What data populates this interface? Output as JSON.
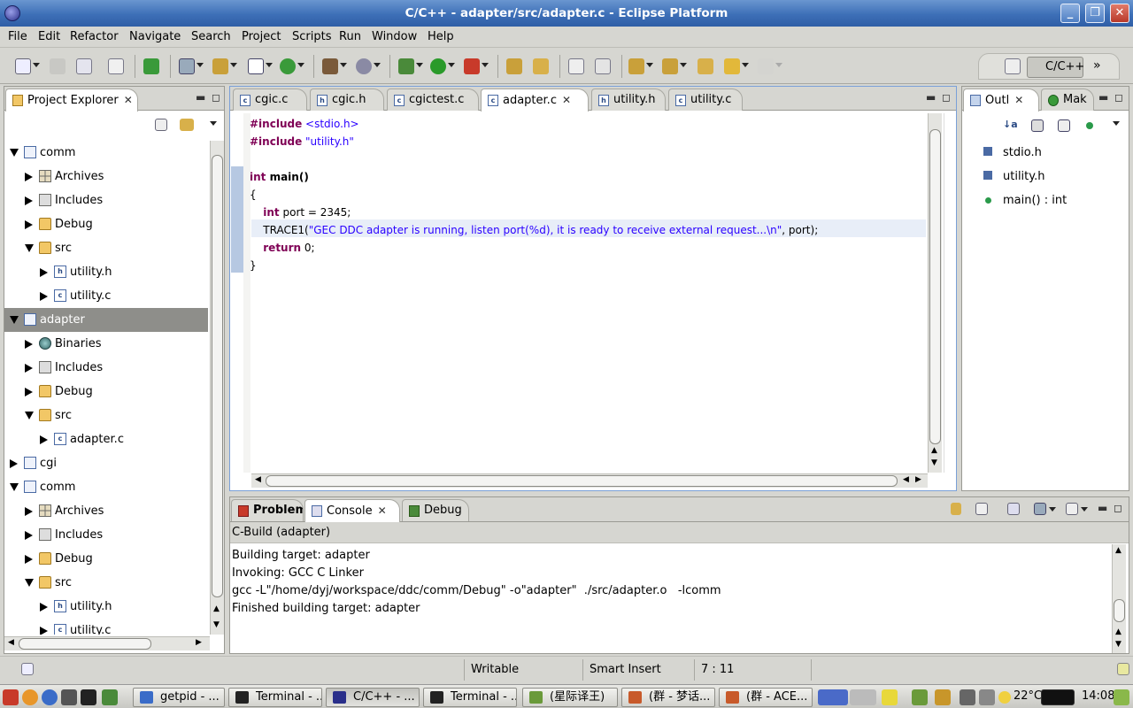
{
  "window": {
    "title": "C/C++ - adapter/src/adapter.c - Eclipse Platform",
    "min": "_",
    "max": "❐",
    "close": "✕"
  },
  "menu": [
    "File",
    "Edit",
    "Refactor",
    "Navigate",
    "Search",
    "Project",
    "Scripts",
    "Run",
    "Window",
    "Help"
  ],
  "perspective": {
    "label": "C/C++",
    "more": "»"
  },
  "explorer": {
    "title": "Project Explorer",
    "tree": [
      {
        "label": "comm",
        "depth": 0,
        "state": "open",
        "icon": "project-icon"
      },
      {
        "label": "Archives",
        "depth": 1,
        "state": "closed",
        "icon": "archive-icon"
      },
      {
        "label": "Includes",
        "depth": 1,
        "state": "closed",
        "icon": "includes-icon"
      },
      {
        "label": "Debug",
        "depth": 1,
        "state": "closed",
        "icon": "folder-icon"
      },
      {
        "label": "src",
        "depth": 1,
        "state": "open",
        "icon": "folder-icon"
      },
      {
        "label": "utility.h",
        "depth": 2,
        "state": "closed",
        "icon": "header-file-icon"
      },
      {
        "label": "utility.c",
        "depth": 2,
        "state": "closed",
        "icon": "c-file-icon"
      },
      {
        "label": "adapter",
        "depth": 0,
        "state": "open",
        "icon": "project-icon",
        "selected": true
      },
      {
        "label": "Binaries",
        "depth": 1,
        "state": "closed",
        "icon": "binaries-icon"
      },
      {
        "label": "Includes",
        "depth": 1,
        "state": "closed",
        "icon": "includes-icon"
      },
      {
        "label": "Debug",
        "depth": 1,
        "state": "closed",
        "icon": "folder-icon"
      },
      {
        "label": "src",
        "depth": 1,
        "state": "open",
        "icon": "folder-icon"
      },
      {
        "label": "adapter.c",
        "depth": 2,
        "state": "closed",
        "icon": "c-file-icon"
      },
      {
        "label": "cgi",
        "depth": 0,
        "state": "closed",
        "icon": "project-icon"
      },
      {
        "label": "comm",
        "depth": 0,
        "state": "open",
        "icon": "project-icon"
      },
      {
        "label": "Archives",
        "depth": 1,
        "state": "closed",
        "icon": "archive-icon"
      },
      {
        "label": "Includes",
        "depth": 1,
        "state": "closed",
        "icon": "includes-icon"
      },
      {
        "label": "Debug",
        "depth": 1,
        "state": "closed",
        "icon": "folder-icon"
      },
      {
        "label": "src",
        "depth": 1,
        "state": "open",
        "icon": "folder-icon"
      },
      {
        "label": "utility.h",
        "depth": 2,
        "state": "closed",
        "icon": "header-file-icon"
      },
      {
        "label": "utility.c",
        "depth": 2,
        "state": "closed",
        "icon": "c-file-icon"
      }
    ]
  },
  "editor": {
    "tabs": [
      {
        "label": "cgic.c",
        "icon": "c",
        "active": false
      },
      {
        "label": "cgic.h",
        "icon": "h",
        "active": false
      },
      {
        "label": "cgictest.c",
        "icon": "c",
        "active": false
      },
      {
        "label": "adapter.c",
        "icon": "c",
        "active": true
      },
      {
        "label": "utility.h",
        "icon": "h",
        "active": false
      },
      {
        "label": "utility.c",
        "icon": "c",
        "active": false
      }
    ],
    "code": {
      "inc1_kw": "#include",
      "inc1_arg": " <stdio.h>",
      "inc2_kw": "#include",
      "inc2_arg": " \"utility.h\"",
      "main_kw": "int",
      "main_rest": " main()",
      "brace_open": "{",
      "port_indent": "    ",
      "port_kw": "int",
      "port_rest": " port = 2345;",
      "trace_pre": "    TRACE1(",
      "trace_str": "\"GEC DDC adapter is running, listen port(%d), it is ready to receive external request...\\n\"",
      "trace_post": ", port);",
      "ret_indent": "    ",
      "ret_kw": "return",
      "ret_rest": " 0;",
      "brace_close": "}"
    }
  },
  "outline": {
    "title": "Outl",
    "make_title": "Mak",
    "items": [
      {
        "label": "stdio.h",
        "icon": "include-icon"
      },
      {
        "label": "utility.h",
        "icon": "include-icon"
      },
      {
        "label": "main() : int",
        "icon": "function-icon"
      }
    ]
  },
  "bottom": {
    "tabs": [
      {
        "label": "Problems",
        "active": false
      },
      {
        "label": "Console",
        "active": true
      },
      {
        "label": "Debug",
        "active": false
      }
    ],
    "console_title": "C-Build (adapter)",
    "lines": [
      "Building target: adapter",
      "Invoking: GCC C Linker",
      "gcc -L\"/home/dyj/workspace/ddc/comm/Debug\" -o\"adapter\"  ./src/adapter.o   -lcomm",
      "Finished building target: adapter"
    ]
  },
  "status": {
    "writable": "Writable",
    "insert": "Smart Insert",
    "position": "7 : 11"
  },
  "taskbar": {
    "tasks": [
      {
        "label": "getpid - ...",
        "active": false,
        "color": "#3a6cc8"
      },
      {
        "label": "Terminal - ...",
        "active": false,
        "color": "#222222"
      },
      {
        "label": "C/C++ - ...",
        "active": true,
        "color": "#2a2f8a"
      },
      {
        "label": "Terminal - ...",
        "active": false,
        "color": "#222222"
      },
      {
        "label": "(星际译王)",
        "active": false,
        "color": "#6a9a3a"
      },
      {
        "label": "(群 - 梦话...",
        "active": false,
        "color": "#c85a2a"
      },
      {
        "label": "(群 - ACE...",
        "active": false,
        "color": "#c85a2a"
      }
    ],
    "temperature": "22°C",
    "clock": "14:08"
  }
}
